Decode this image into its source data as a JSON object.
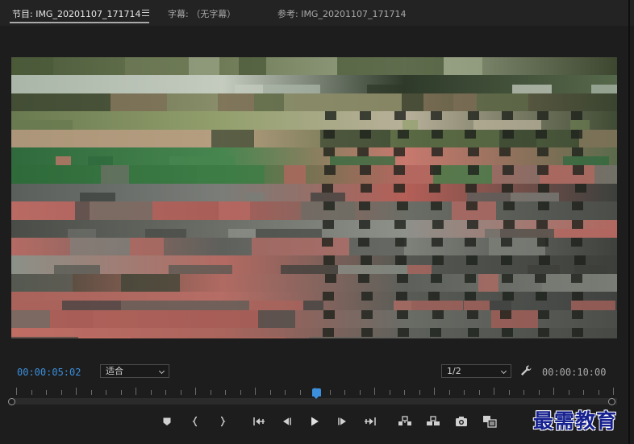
{
  "tabs": [
    {
      "label": "节目: IMG_20201107_171714"
    },
    {
      "label": "字幕: （无字幕）"
    },
    {
      "label": "参考: IMG_20201107_171714"
    }
  ],
  "program": {
    "current_timecode": "00:00:05:02",
    "total_duration": "00:00:10:00",
    "zoom_selected": "适合",
    "resolution_selected": "1/2",
    "playhead_position_fraction": 0.505
  },
  "transport": {
    "buttons": [
      {
        "name": "add-marker",
        "icon": "marker-icon"
      },
      {
        "name": "mark-in",
        "icon": "mark-in-icon"
      },
      {
        "name": "mark-out",
        "icon": "mark-out-icon"
      },
      {
        "name": "go-to-in",
        "icon": "go-to-in-icon"
      },
      {
        "name": "step-back",
        "icon": "step-back-icon"
      },
      {
        "name": "play",
        "icon": "play-icon"
      },
      {
        "name": "step-forward",
        "icon": "step-forward-icon"
      },
      {
        "name": "go-to-out",
        "icon": "go-to-out-icon"
      },
      {
        "name": "lift",
        "icon": "lift-icon"
      },
      {
        "name": "extract",
        "icon": "extract-icon"
      },
      {
        "name": "export-frame",
        "icon": "camera-icon"
      },
      {
        "name": "comparison-view",
        "icon": "comparison-icon"
      }
    ]
  },
  "watermark": {
    "text": "最需教育"
  },
  "colors": {
    "accent": "#3b8fdc",
    "background": "#1d1d1d",
    "watermark": "#16218f"
  }
}
